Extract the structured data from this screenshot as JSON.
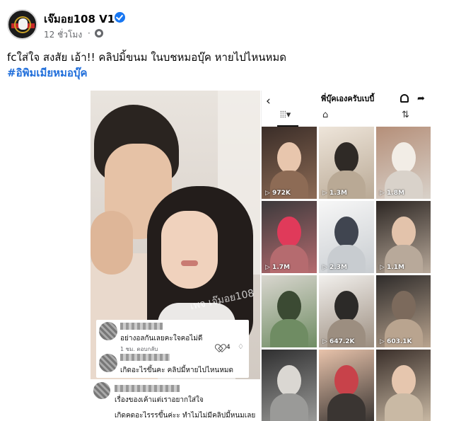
{
  "post": {
    "page_name": "เจ๊มอย108 V1",
    "time": "12 ชั่วโมง",
    "dot": "·",
    "caption": "fcใส่ใจ  สงสัย เอ้า!! คลิปมิ้ขนม ในบชหมอบุ๊ค หายไปไหนหมด",
    "hashtag": "#อิพิมเมียหมอบุ๊ค",
    "icons": {
      "verified": "verified-badge-icon",
      "audience": "globe-icon"
    },
    "colors": {
      "link": "#216fdb",
      "verified": "#1877f2"
    }
  },
  "left_photo": {
    "watermark": "เพจ เจ๊มอย108",
    "comment1": {
      "text": "อย่างอลกันเลยคะใจคอไม่ดี",
      "meta": "1 ชม.   ตอบกลับ",
      "likes": "4"
    },
    "comment2": {
      "text": "เกิดอะไรขึ้นคะ คลิปมี้หายไปไหนหมด"
    },
    "comment3": {
      "text1": "เรื่องของเค้าแต่เราอยากใส่ใจ",
      "text2": "เกิดคดอะไรรรขึ้นค่ะะ ทำไมไม่มีคลิปมี้หนมเลย"
    }
  },
  "profile": {
    "back": "‹",
    "title": "พี่บุ๊คเองครับเบบี้",
    "share": "➦",
    "tabs": {
      "grid": "⦙⦙⦙▾",
      "shop": "⌂",
      "repost": "⇅"
    },
    "views": [
      "972K",
      "1.3M",
      "1.8M",
      "1.7M",
      "2.3M",
      "1.1M",
      "",
      "647.2K",
      "603.1K",
      "",
      "",
      ""
    ]
  }
}
